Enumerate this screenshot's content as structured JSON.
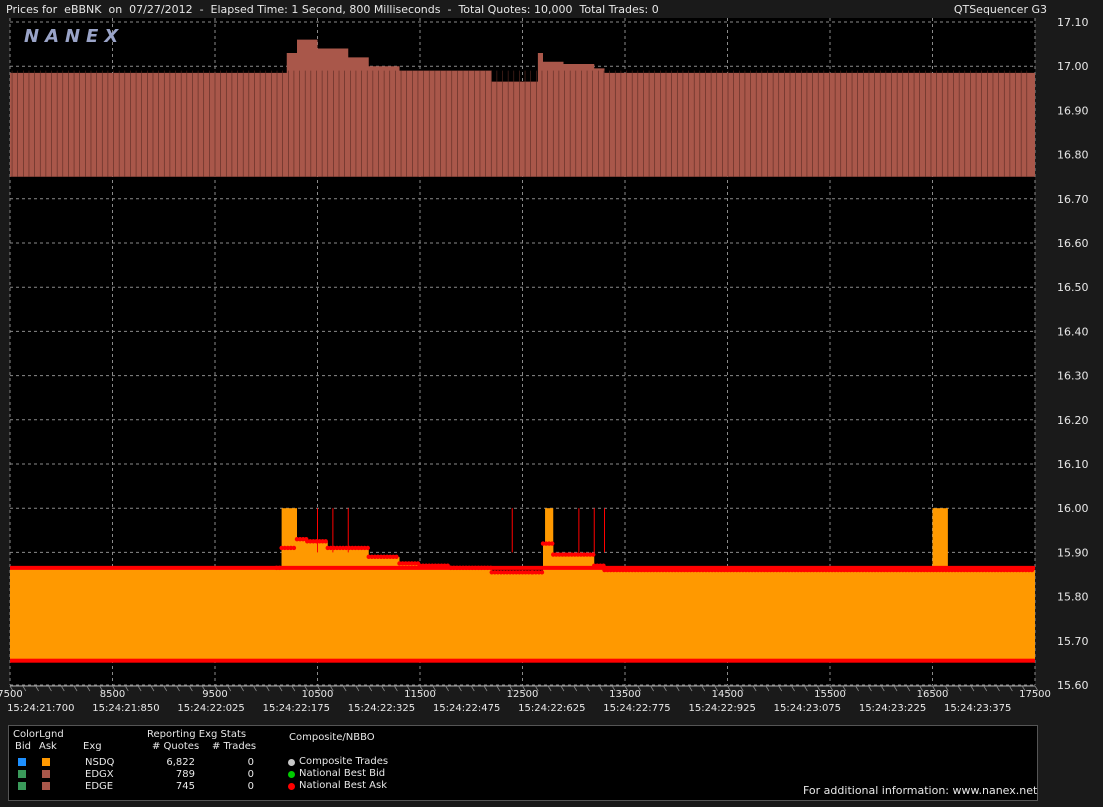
{
  "header": {
    "title": "Prices for  eBBNK  on  07/27/2012  -  Elapsed Time: 1 Second, 800 Milliseconds  -  Total Quotes: 10,000  Total Trades: 0",
    "app": "QTSequencer G3"
  },
  "watermark": "NANEX",
  "colors": {
    "background": "#000000",
    "grid": "#8a8a8a",
    "bid_fill": "#ff9900",
    "ask_fill": "#a9574a",
    "nbbo_bid": "#00cc00",
    "nbbo_ask": "#ff0000",
    "composite_trades": "#c8c8c8",
    "nsdq_bid": "#1e90ff",
    "edgx_bid": "#3a9a5a",
    "edge_bid": "#3a9a5a",
    "nsdq_ask": "#ff9900",
    "edgx_ask": "#a9574a",
    "edge_ask": "#a9574a"
  },
  "chart_data": {
    "type": "area",
    "x_ticks": [
      7500,
      8500,
      9500,
      10500,
      11500,
      12500,
      13500,
      14500,
      15500,
      16500,
      17500
    ],
    "x_time_labels": [
      "15:24:21:700",
      "15:24:21:850",
      "15:24:22:025",
      "15:24:22:175",
      "15:24:22:325",
      "15:24:22:475",
      "15:24:22:625",
      "15:24:22:775",
      "15:24:22:925",
      "15:24:23:075",
      "15:24:23:225",
      "15:24:23:375"
    ],
    "x_range": [
      7500,
      17500
    ],
    "y_ticks": [
      "17.10",
      "17.00",
      "16.90",
      "16.80",
      "16.70",
      "16.60",
      "16.50",
      "16.40",
      "16.30",
      "16.20",
      "16.10",
      "16.00",
      "15.90",
      "15.80",
      "15.70",
      "15.60"
    ],
    "y_range": [
      15.6,
      17.1
    ],
    "grid": true,
    "series": [
      {
        "name": "NSDQ",
        "role": "bid",
        "x": [
          7500,
          10100,
          10150,
          10300,
          10400,
          10600,
          11000,
          11300,
          11500,
          11800,
          12200,
          12600,
          12700,
          12800,
          13200,
          13300,
          17500
        ],
        "values": [
          15.865,
          15.865,
          15.91,
          15.93,
          15.925,
          15.91,
          15.89,
          15.875,
          15.87,
          15.865,
          15.855,
          15.855,
          15.92,
          15.895,
          15.87,
          15.86,
          15.86
        ]
      },
      {
        "name": "EDGX",
        "role": "ask",
        "x": [
          7500,
          10150,
          10200,
          10300,
          10500,
          10800,
          11000,
          11300,
          12200,
          12600,
          12650,
          12700,
          12900,
          13200,
          13300,
          17500
        ],
        "values": [
          16.985,
          16.985,
          17.03,
          17.06,
          17.04,
          17.02,
          17.0,
          16.99,
          16.965,
          16.965,
          17.03,
          17.01,
          17.005,
          16.995,
          16.985,
          16.985
        ]
      },
      {
        "name": "EDGE",
        "role": "ask",
        "x": [
          7500,
          17500
        ],
        "values": [
          16.75,
          16.75
        ]
      }
    ],
    "spikes": [
      {
        "x": [
          10150,
          10300
        ],
        "value": 16.0
      },
      {
        "x": [
          12720,
          12800
        ],
        "value": 16.0
      },
      {
        "x": [
          16500,
          16650
        ],
        "value": 16.0
      }
    ],
    "nbbo_ask_line": 15.865,
    "nbbo_bid_line": 15.655
  },
  "legend": {
    "colorlgnd_title": "ColorLgnd",
    "bid_header": "Bid",
    "ask_header": "Ask",
    "exg_header": "Exg",
    "reporting_title": "Reporting Exg Stats",
    "quotes_header": "# Quotes",
    "trades_header": "# Trades",
    "composite_title": "Composite/NBBO",
    "rows": [
      {
        "exg": "NSDQ",
        "quotes": "6,822",
        "trades": "0"
      },
      {
        "exg": "EDGX",
        "quotes": "789",
        "trades": "0"
      },
      {
        "exg": "EDGE",
        "quotes": "745",
        "trades": "0"
      }
    ],
    "composite_items": [
      "Composite Trades",
      "National Best Bid",
      "National Best Ask"
    ],
    "footer": "For additional information: www.nanex.net"
  }
}
